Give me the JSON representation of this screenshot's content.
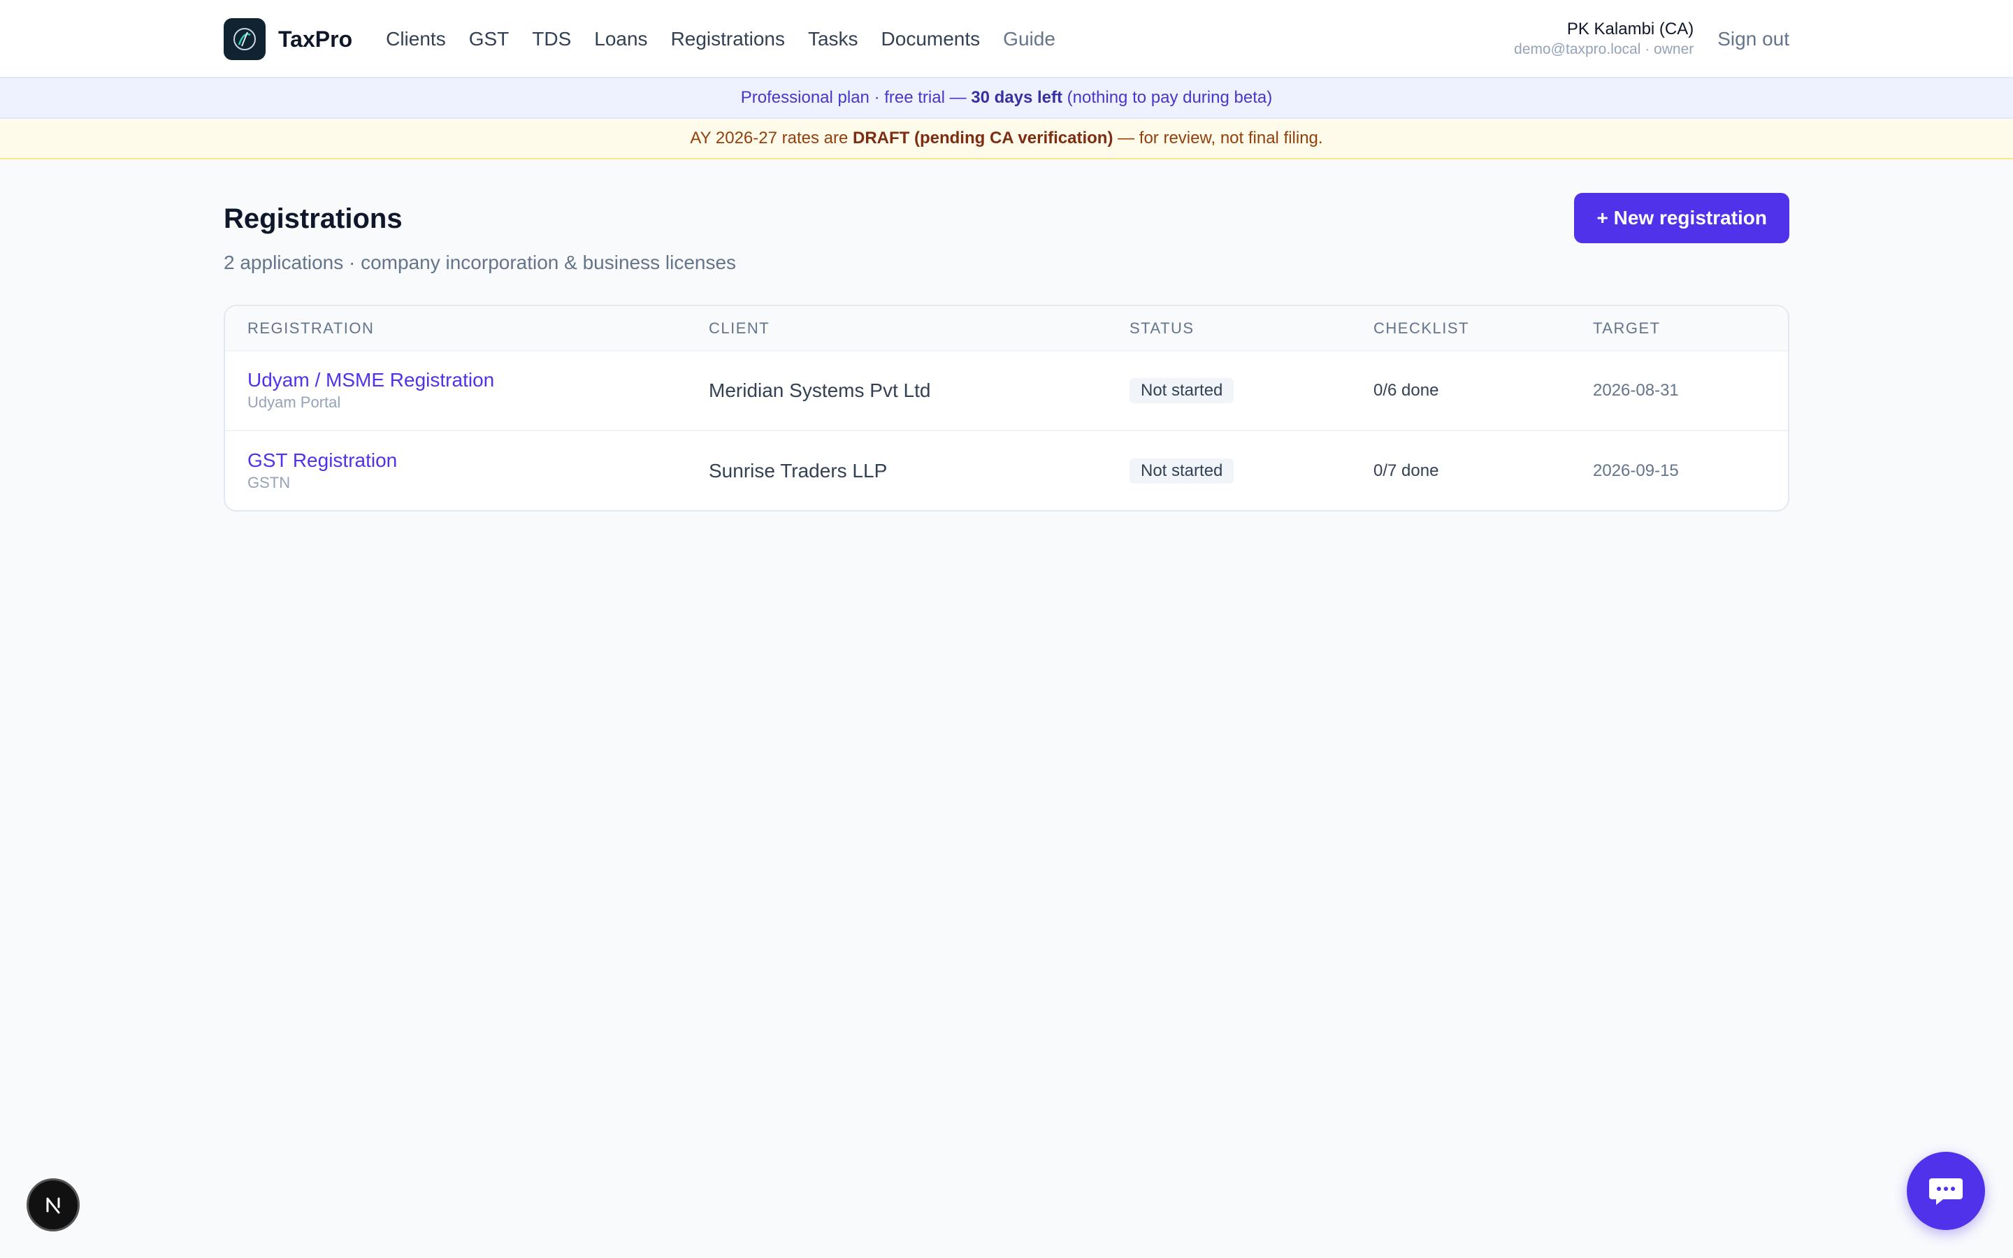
{
  "header": {
    "brand": "TaxPro",
    "nav": [
      {
        "label": "Clients"
      },
      {
        "label": "GST"
      },
      {
        "label": "TDS"
      },
      {
        "label": "Loans"
      },
      {
        "label": "Registrations"
      },
      {
        "label": "Tasks"
      },
      {
        "label": "Documents"
      },
      {
        "label": "Guide"
      }
    ],
    "user_name": "PK Kalambi (CA)",
    "user_email": "demo@taxpro.local · owner",
    "sign_out": "Sign out"
  },
  "plan_banner": {
    "prefix": "Professional plan · free trial — ",
    "highlight": "30 days left",
    "suffix": " (nothing to pay during beta)"
  },
  "draft_banner": {
    "prefix": "AY 2026-27 rates are ",
    "highlight": "DRAFT (pending CA verification)",
    "suffix": " — for review, not final filing."
  },
  "page": {
    "title": "Registrations",
    "subtitle": "2 applications · company incorporation & business licenses",
    "new_button": "+ New registration"
  },
  "table": {
    "columns": [
      "REGISTRATION",
      "CLIENT",
      "STATUS",
      "CHECKLIST",
      "TARGET"
    ],
    "rows": [
      {
        "name": "Udyam / MSME Registration",
        "portal": "Udyam Portal",
        "client": "Meridian Systems Pvt Ltd",
        "status": "Not started",
        "checklist": "0/6 done",
        "target": "2026-08-31"
      },
      {
        "name": "GST Registration",
        "portal": "GSTN",
        "client": "Sunrise Traders LLP",
        "status": "Not started",
        "checklist": "0/7 done",
        "target": "2026-09-15"
      }
    ]
  },
  "floating": {
    "next_badge": "N",
    "chat_icon": "chat-bubble-icon"
  },
  "colors": {
    "accent": "#4f32ea",
    "plan_banner_bg": "#eef2ff",
    "draft_banner_bg": "#fffbeb"
  }
}
